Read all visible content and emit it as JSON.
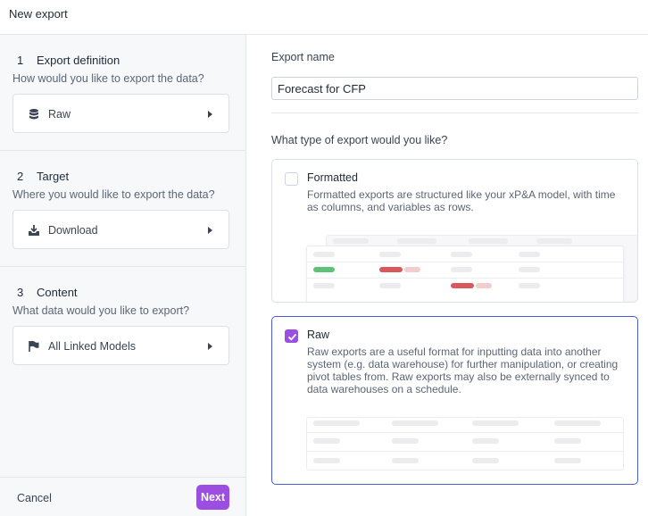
{
  "window": {
    "title": "New export"
  },
  "steps": [
    {
      "number": "1",
      "title": "Export definition",
      "question": "How would you like to export the data?",
      "value": "Raw",
      "icon": "database-icon"
    },
    {
      "number": "2",
      "title": "Target",
      "question": "Where you would like to export the data?",
      "value": "Download",
      "icon": "download-icon"
    },
    {
      "number": "3",
      "title": "Content",
      "question": "What data would you like to export?",
      "value": "All Linked Models",
      "icon": "flag-icon"
    }
  ],
  "footer": {
    "cancel_label": "Cancel",
    "next_label": "Next"
  },
  "form": {
    "name_label": "Export name",
    "name_value": "Forecast for CFP",
    "type_question": "What type of export would you like?"
  },
  "options": [
    {
      "title": "Formatted",
      "description": "Formatted exports are structured like your xP&A model, with time as columns, and variables as rows.",
      "selected": false
    },
    {
      "title": "Raw",
      "description": "Raw exports are a useful format for inputting data into another system (e.g. data warehouse) for further manipulation, or creating pivot tables from. Raw exports may also be externally synced to data warehouses on a schedule.",
      "selected": true
    }
  ],
  "colors": {
    "accent": "#9b4ee0",
    "selected_border": "#4a5bd4",
    "green_chip": "#5ec27a",
    "red_chip": "#d9585c",
    "pink_chip": "#f3cccd"
  }
}
